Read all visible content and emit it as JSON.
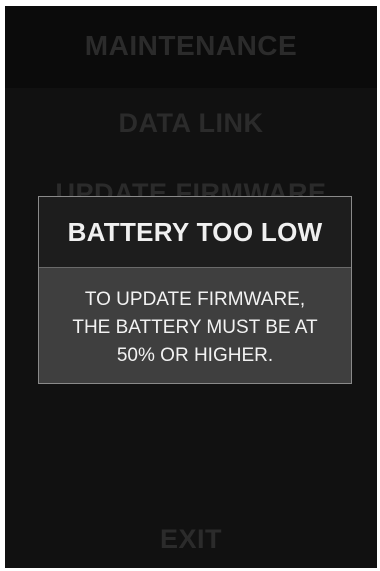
{
  "screen": {
    "header_title": "MAINTENANCE",
    "menu": [
      {
        "label": "DATA LINK"
      },
      {
        "label": "UPDATE FIRMWARE"
      },
      {
        "label": "EXIT"
      }
    ]
  },
  "dialog": {
    "title": "BATTERY TOO LOW",
    "message_lines": [
      "TO UPDATE FIRMWARE,",
      "THE BATTERY MUST BE AT",
      "50% OR HIGHER."
    ]
  },
  "colors": {
    "background": "#111111",
    "header_band": "#0b0b0b",
    "dim_text": "#2b2b2b",
    "dialog_header": "#1d1d1d",
    "dialog_body": "#3f3f3f",
    "dialog_text": "#f0f0f0"
  }
}
